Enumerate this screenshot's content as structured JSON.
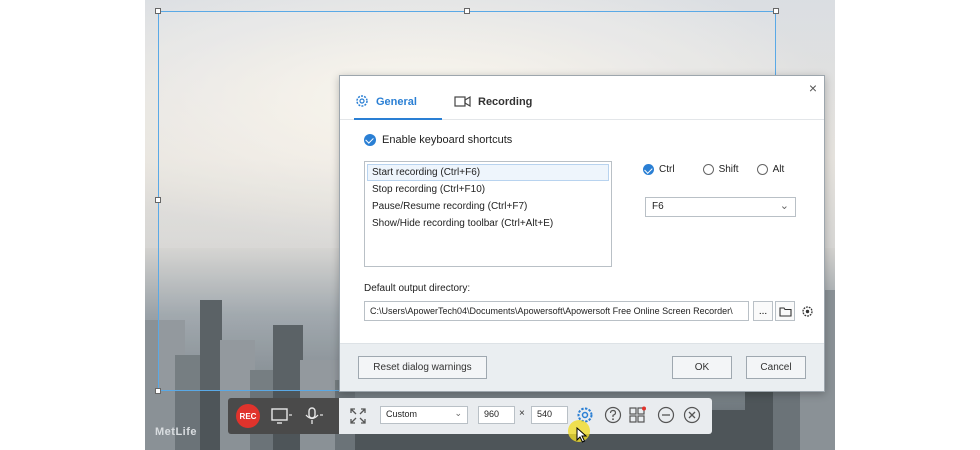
{
  "background": {
    "watermark_text": "MetLife"
  },
  "dialog": {
    "tabs": [
      {
        "label": "General",
        "icon": "gear-icon"
      },
      {
        "label": "Recording",
        "icon": "camera-icon"
      }
    ],
    "enable_shortcuts_label": "Enable keyboard shortcuts",
    "shortcuts": [
      "Start recording (Ctrl+F6)",
      "Stop recording (Ctrl+F10)",
      "Pause/Resume recording (Ctrl+F7)",
      "Show/Hide recording toolbar (Ctrl+Alt+E)"
    ],
    "modifiers": {
      "ctrl": "Ctrl",
      "shift": "Shift",
      "alt": "Alt"
    },
    "key_value": "F6",
    "output_dir_label": "Default output directory:",
    "output_dir_value": "C:\\Users\\ApowerTech04\\Documents\\Apowersoft\\Apowersoft Free Online Screen Recorder\\",
    "browse_label": "...",
    "reset_label": "Reset dialog warnings",
    "ok_label": "OK",
    "cancel_label": "Cancel",
    "close_label": "×"
  },
  "toolbar": {
    "rec_label": "REC",
    "preset_value": "Custom",
    "width_value": "960",
    "times_label": "×",
    "height_value": "540",
    "colors": {
      "rec": "#e0332c",
      "accent": "#2a7fd4"
    }
  }
}
